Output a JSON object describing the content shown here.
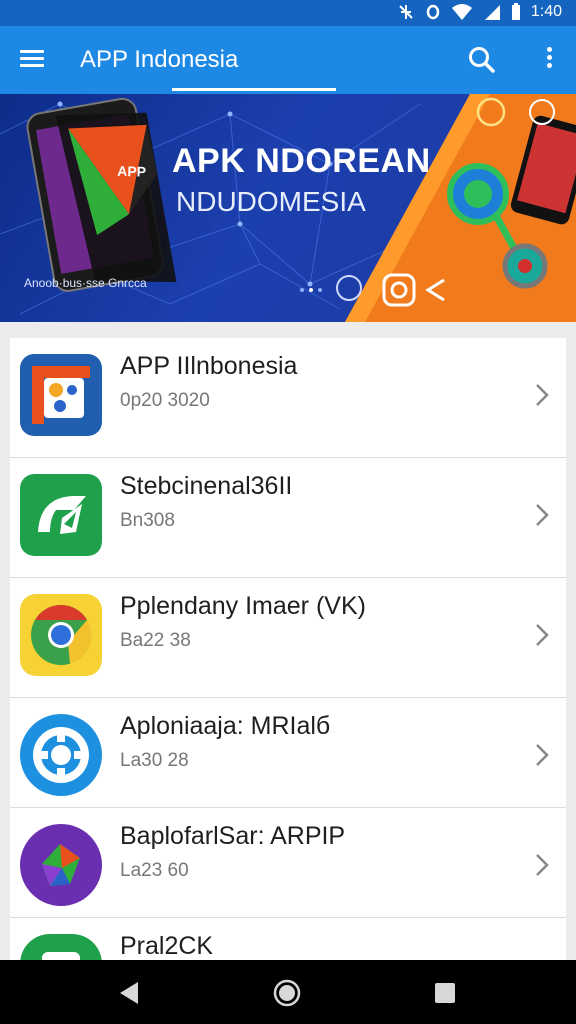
{
  "status_bar": {
    "time": "1:40",
    "icons": [
      "notification-icon",
      "sync-icon",
      "wifi-icon",
      "signal-icon",
      "battery-icon"
    ]
  },
  "app_bar": {
    "title": "APP Indonesia",
    "menu_icon": "hamburger-menu-icon",
    "search_icon": "search-icon",
    "more_icon": "overflow-menu-icon"
  },
  "banner": {
    "title": "APK NDOREAN",
    "subtitle": "NDUDOMESIA",
    "caption": "Anoob·bus·sse Gnrcca",
    "phone_label": "APP",
    "dots": 3,
    "active_dot": 1
  },
  "apps": [
    {
      "name": "APP IIlnbonesia",
      "meta": "0p20 3020",
      "icon": "google-photos-icon"
    },
    {
      "name": "Stebcinenal36II",
      "meta": "Bn308",
      "icon": "green-app-icon"
    },
    {
      "name": "Pplendany Imaer (VK)",
      "meta": "Ba22 38",
      "icon": "chrome-icon"
    },
    {
      "name": "Aploniaaja: MRIalб",
      "meta": "La30 28",
      "icon": "blue-gear-app-icon"
    },
    {
      "name": "BaplofarlSar: ARPIP",
      "meta": "La23 60",
      "icon": "purple-app-icon"
    },
    {
      "name": "Pral2CK",
      "meta": "",
      "icon": "green-app-icon-partial"
    }
  ],
  "colors": {
    "app_bar": "#1e88e5",
    "status_bar": "#1565c0",
    "banner_blue": "#1c3fae",
    "banner_orange": "#f48c1f"
  },
  "nav_bar": {
    "back_icon": "back-triangle-icon",
    "home_icon": "home-circle-icon",
    "recents_icon": "recents-square-icon"
  }
}
